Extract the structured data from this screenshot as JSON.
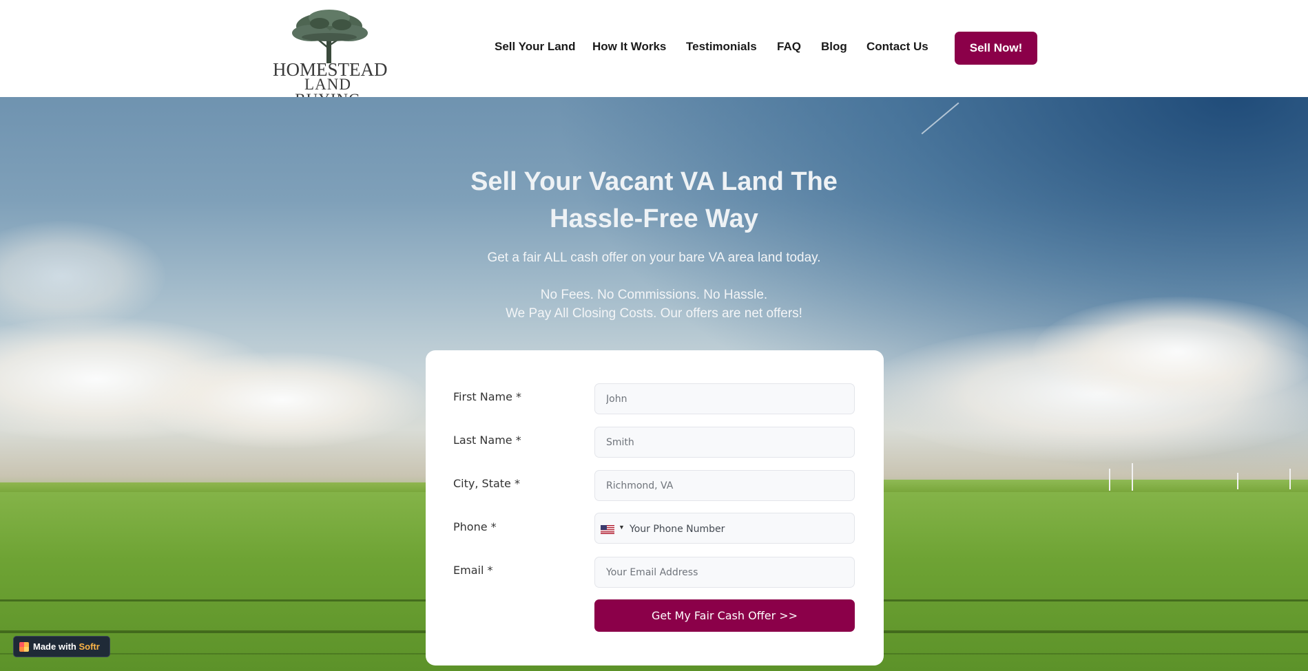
{
  "brand": {
    "logo_line1": "HOMESTEAD",
    "logo_line2": "LAND BUYING"
  },
  "nav": {
    "items": [
      {
        "label": "Sell Your Land"
      },
      {
        "label": "How It Works"
      },
      {
        "label": "Testimonials"
      },
      {
        "label": "FAQ"
      },
      {
        "label": "Blog"
      },
      {
        "label": "Contact Us"
      }
    ],
    "cta_label": "Sell Now!"
  },
  "hero": {
    "title_line1": "Sell Your Vacant VA Land The",
    "title_line2": "Hassle-Free Way",
    "subtitle": "Get a fair ALL cash offer on your bare VA area land today.",
    "tagline_line1": "No Fees. No Commissions. No Hassle.",
    "tagline_line2": "We Pay All Closing Costs. Our offers are net offers!"
  },
  "form": {
    "first_name": {
      "label": "First Name *",
      "placeholder": "John"
    },
    "last_name": {
      "label": "Last Name *",
      "placeholder": "Smith"
    },
    "city_state": {
      "label": "City, State *",
      "placeholder": "Richmond, VA"
    },
    "phone": {
      "label": "Phone *",
      "placeholder": "Your Phone Number",
      "country_flag": "us-flag-icon"
    },
    "email": {
      "label": "Email *",
      "placeholder": "Your Email Address"
    },
    "submit_label": "Get My Fair Cash Offer >>"
  },
  "badge": {
    "prefix": "Made with",
    "brand": "Softr"
  },
  "colors": {
    "accent": "#8b0049",
    "badge_bg": "#1f2a37",
    "badge_brand": "#ffb547"
  }
}
